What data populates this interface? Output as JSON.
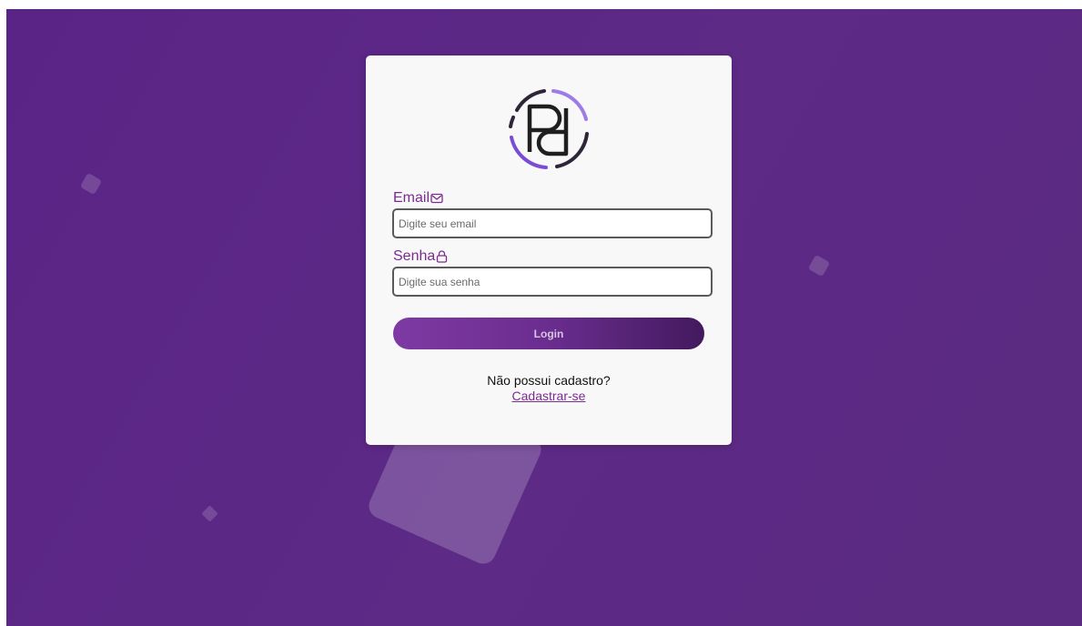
{
  "colors": {
    "background": "#5d2a86",
    "card": "#f8f8f8",
    "label": "#7d2a93",
    "button_start": "#7e3aa3",
    "button_end": "#431a5e"
  },
  "form": {
    "email": {
      "label": "Email",
      "icon": "envelope-icon",
      "placeholder": "Digite seu email",
      "value": ""
    },
    "password": {
      "label": "Senha",
      "icon": "lock-icon",
      "placeholder": "Digite sua senha",
      "value": ""
    },
    "login_label": "Login"
  },
  "signup": {
    "prompt": "Não possui cadastro?",
    "link_label": "Cadastrar-se"
  },
  "logo": {
    "icon": "pd-logo-icon"
  }
}
